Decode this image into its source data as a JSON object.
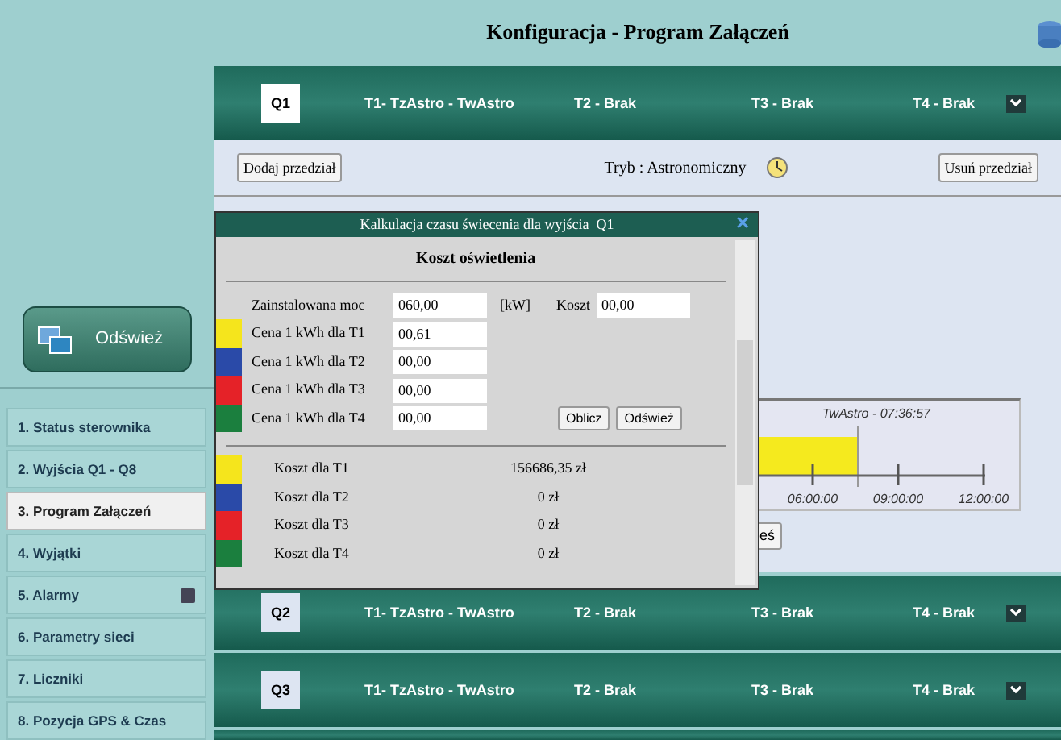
{
  "page_title": "Konfiguracja - Program Załączeń",
  "sidebar": {
    "refresh_button": "Odśwież",
    "items": [
      {
        "label": "1. Status sterownika",
        "selected": false,
        "has_icon": false
      },
      {
        "label": "2. Wyjścia Q1 - Q8",
        "selected": false,
        "has_icon": false
      },
      {
        "label": "3. Program Załączeń",
        "selected": true,
        "has_icon": false
      },
      {
        "label": "4. Wyjątki",
        "selected": false,
        "has_icon": false
      },
      {
        "label": "5. Alarmy",
        "selected": false,
        "has_icon": true
      },
      {
        "label": "6. Parametry sieci",
        "selected": false,
        "has_icon": false
      },
      {
        "label": "7. Liczniki",
        "selected": false,
        "has_icon": false
      },
      {
        "label": "8. Pozycja GPS & Czas",
        "selected": false,
        "has_icon": false
      }
    ]
  },
  "outputs": [
    {
      "name": "Q1",
      "expanded": true,
      "intervals": [
        "T1- TzAstro - TwAstro",
        "T2 - Brak",
        "T3 - Brak",
        "T4 - Brak"
      ]
    },
    {
      "name": "Q2",
      "expanded": false,
      "intervals": [
        "T1- TzAstro - TwAstro",
        "T2 - Brak",
        "T3 - Brak",
        "T4 - Brak"
      ]
    },
    {
      "name": "Q3",
      "expanded": false,
      "intervals": [
        "T1- TzAstro - TwAstro",
        "T2 - Brak",
        "T3 - Brak",
        "T4 - Brak"
      ]
    }
  ],
  "panel": {
    "add_button": "Dodaj przedział",
    "mode": "Tryb : Astronomiczny",
    "remove_button": "Usuń przedział",
    "hidden_button": "eś",
    "timeline": {
      "marker_label": "TwAstro - 07:36:57",
      "ticks": [
        "06:00:00",
        "09:00:00",
        "12:00:00"
      ]
    }
  },
  "dialog": {
    "title": "Kalkulacja czasu świecenia dla wyjścia  Q1",
    "close_glyph": "✕",
    "section_title": "Koszt oświetlenia",
    "power": {
      "label": "Zainstalowana moc",
      "value": "060,00",
      "unit": "[kW]",
      "cost_label": "Koszt",
      "cost_value": "00,00"
    },
    "prices": [
      {
        "label": "Cena 1 kWh dla T1",
        "value": "00,61",
        "color": "#f5e51c"
      },
      {
        "label": "Cena 1 kWh dla T2",
        "value": "00,00",
        "color": "#2a4aa8"
      },
      {
        "label": "Cena 1 kWh dla T3",
        "value": "00,00",
        "color": "#e52228"
      },
      {
        "label": "Cena 1 kWh dla T4",
        "value": "00,00",
        "color": "#1b7f3e"
      }
    ],
    "buttons": [
      "Oblicz",
      "Odśwież"
    ],
    "costs": [
      {
        "label": "Koszt dla T1",
        "value": "156686,35 zł",
        "color": "#f5e51c"
      },
      {
        "label": "Koszt dla T2",
        "value": "0 zł",
        "color": "#2a4aa8"
      },
      {
        "label": "Koszt dla T3",
        "value": "0 zł",
        "color": "#e52228"
      },
      {
        "label": "Koszt dla T4",
        "value": "0 zł",
        "color": "#1b7f3e"
      }
    ]
  }
}
